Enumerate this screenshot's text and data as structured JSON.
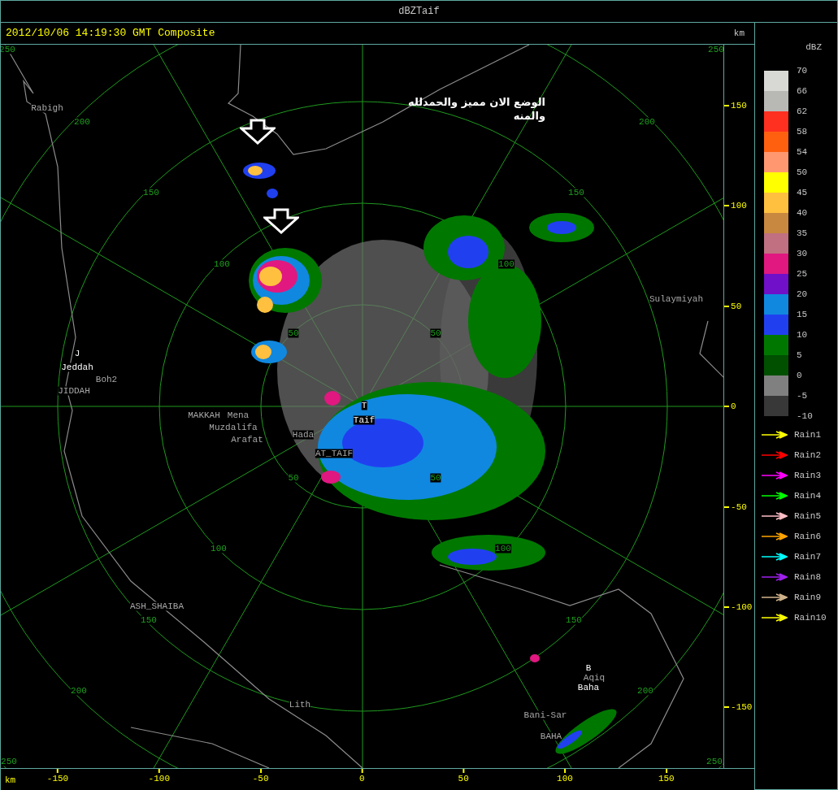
{
  "window_title": "dBZTaif",
  "header": {
    "timestamp": "2012/10/06 14:19:30 GMT Composite",
    "unit": "km"
  },
  "map": {
    "ring_labels": [
      "250",
      "250",
      "200",
      "200",
      "150",
      "150",
      "100",
      "100",
      "50",
      "50",
      "50",
      "50",
      "100",
      "100",
      "150",
      "150",
      "200",
      "200",
      "250",
      "250"
    ],
    "places": [
      {
        "name": "Rabigh",
        "highlighted": false
      },
      {
        "name": "J",
        "highlighted": true
      },
      {
        "name": "Jeddah",
        "highlighted": true
      },
      {
        "name": "Boh2",
        "highlighted": false
      },
      {
        "name": "JIDDAH",
        "highlighted": false
      },
      {
        "name": "MAKKAH",
        "highlighted": false
      },
      {
        "name": "Mena",
        "highlighted": false
      },
      {
        "name": "Muzdalifa",
        "highlighted": false
      },
      {
        "name": "Arafat",
        "highlighted": false
      },
      {
        "name": "Hada",
        "highlighted": false
      },
      {
        "name": "AT_TAIF",
        "highlighted": false
      },
      {
        "name": "T",
        "highlighted": true
      },
      {
        "name": "Taif",
        "highlighted": true
      },
      {
        "name": "Sulaymiyah",
        "highlighted": false
      },
      {
        "name": "ASH_SHAIBA",
        "highlighted": false
      },
      {
        "name": "Lith",
        "highlighted": false
      },
      {
        "name": "B",
        "highlighted": true
      },
      {
        "name": "Aqiq",
        "highlighted": false
      },
      {
        "name": "Baha",
        "highlighted": true
      },
      {
        "name": "Bani-Sar",
        "highlighted": false
      },
      {
        "name": "BAHA",
        "highlighted": false
      }
    ],
    "annotation": [
      "الوضع الان مميز والحمدلله",
      "والمنه"
    ]
  },
  "right_axis": {
    "ticks": [
      "150",
      "100",
      "50",
      "0",
      "-50",
      "-100",
      "-150"
    ]
  },
  "bottom_axis": {
    "unit": "km",
    "ticks": [
      "-150",
      "-100",
      "-50",
      "0",
      "50",
      "100",
      "150"
    ]
  },
  "legend": {
    "title": "dBZ",
    "tick_labels": [
      "70",
      "66",
      "62",
      "58",
      "54",
      "50",
      "45",
      "40",
      "35",
      "30",
      "25",
      "20",
      "15",
      "10",
      "5",
      "0",
      "-5",
      "-10"
    ],
    "bands": [
      {
        "color": "#d8d8d4"
      },
      {
        "color": "#b8b8b4"
      },
      {
        "color": "#ff3020"
      },
      {
        "color": "#ff6010"
      },
      {
        "color": "#ff9870"
      },
      {
        "color": "#ffff00"
      },
      {
        "color": "#ffc040"
      },
      {
        "color": "#c88840"
      },
      {
        "color": "#c07080"
      },
      {
        "color": "#e01880"
      },
      {
        "color": "#7010c8"
      },
      {
        "color": "#1088e0"
      },
      {
        "color": "#2040f0"
      },
      {
        "color": "#007800"
      },
      {
        "color": "#005000"
      },
      {
        "color": "#808080"
      },
      {
        "color": "#383838"
      }
    ]
  },
  "rain_tracks": [
    {
      "label": "Rain1",
      "color": "#ffff00"
    },
    {
      "label": "Rain2",
      "color": "#ff0000"
    },
    {
      "label": "Rain3",
      "color": "#ff00ff"
    },
    {
      "label": "Rain4",
      "color": "#00ff00"
    },
    {
      "label": "Rain5",
      "color": "#ffc0c8"
    },
    {
      "label": "Rain6",
      "color": "#ffa500"
    },
    {
      "label": "Rain7",
      "color": "#00ffff"
    },
    {
      "label": "Rain8",
      "color": "#a020f0"
    },
    {
      "label": "Rain9",
      "color": "#d2b48c"
    },
    {
      "label": "Rain10",
      "color": "#ffff00"
    }
  ]
}
